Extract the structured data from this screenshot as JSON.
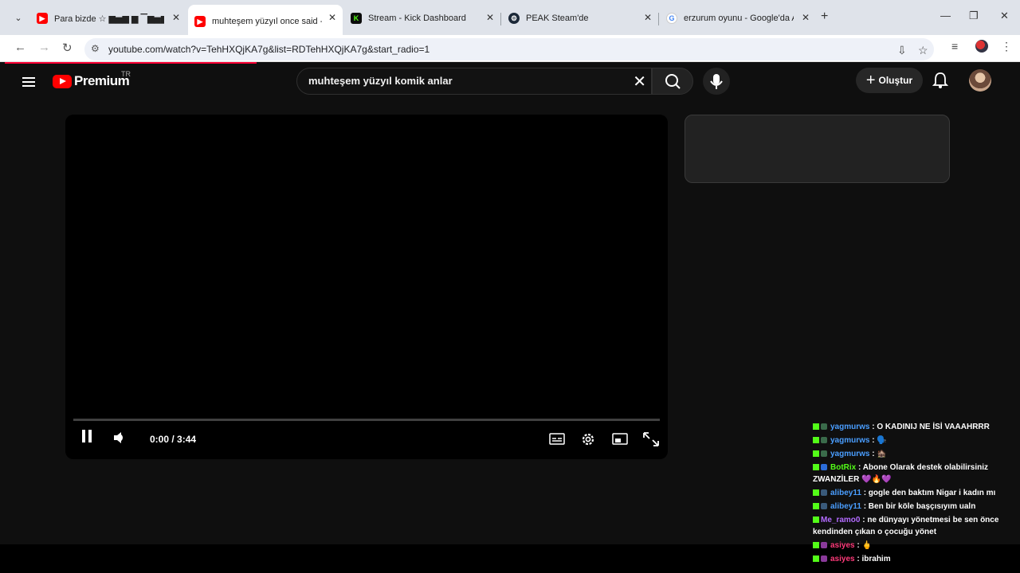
{
  "browser": {
    "tabs": [
      {
        "title": "Para bizde ☆ ▆▅▆ ▆ ▔▆▅▆",
        "favicon": "youtube-icon"
      },
      {
        "title": "muhteşem yüzyıl once said - Yo",
        "favicon": "youtube-icon"
      },
      {
        "title": "Stream - Kick Dashboard",
        "favicon": "kick-icon"
      },
      {
        "title": "PEAK Steam'de",
        "favicon": "steam-icon"
      },
      {
        "title": "erzurum oyunu - Google'da Ara",
        "favicon": "google-icon"
      }
    ],
    "active_tab": 1,
    "url": "youtube.com/watch?v=TehHXQjKA7g&list=RDTehHXQjKA7g&start_radio=1"
  },
  "youtube": {
    "logo_text": "Premium",
    "country_code": "TR",
    "search_query": "muhteşem yüzyıl komik anlar",
    "create_label": "Oluştur",
    "player": {
      "time": "0:00 / 3:44"
    }
  },
  "chat": {
    "messages": [
      {
        "user": "yagmurws",
        "text": ": O KADINIJ NE İSİ VAAAHRRR",
        "color": "#4a9eff"
      },
      {
        "user": "yagmurws",
        "text": ": 🗣️",
        "color": "#4a9eff"
      },
      {
        "user": "yagmurws",
        "text": ": 🏚️",
        "color": "#4a9eff"
      },
      {
        "user": "BotRix",
        "text": ": Abone Olarak destek olabilirsiniz ZWANZİLER 💜🔥💜",
        "color": "#53fc18"
      },
      {
        "user": "alibey11",
        "text": ": gogle den baktım Nigar i kadın mı",
        "color": "#4a9eff"
      },
      {
        "user": "alibey11",
        "text": ": Ben bir köle başçısıyım ualn",
        "color": "#4a9eff"
      },
      {
        "user": "Me_ramo0",
        "text": ": ne dünyayı yönetmesi be sen önce kendinden çıkan o çocuğu yönet",
        "color": "#b36bff"
      },
      {
        "user": "asiyes",
        "text": ": 🖕",
        "color": "#ff3a7a"
      },
      {
        "user": "asiyes",
        "text": ": ibrahim",
        "color": "#ff3a7a"
      }
    ]
  }
}
